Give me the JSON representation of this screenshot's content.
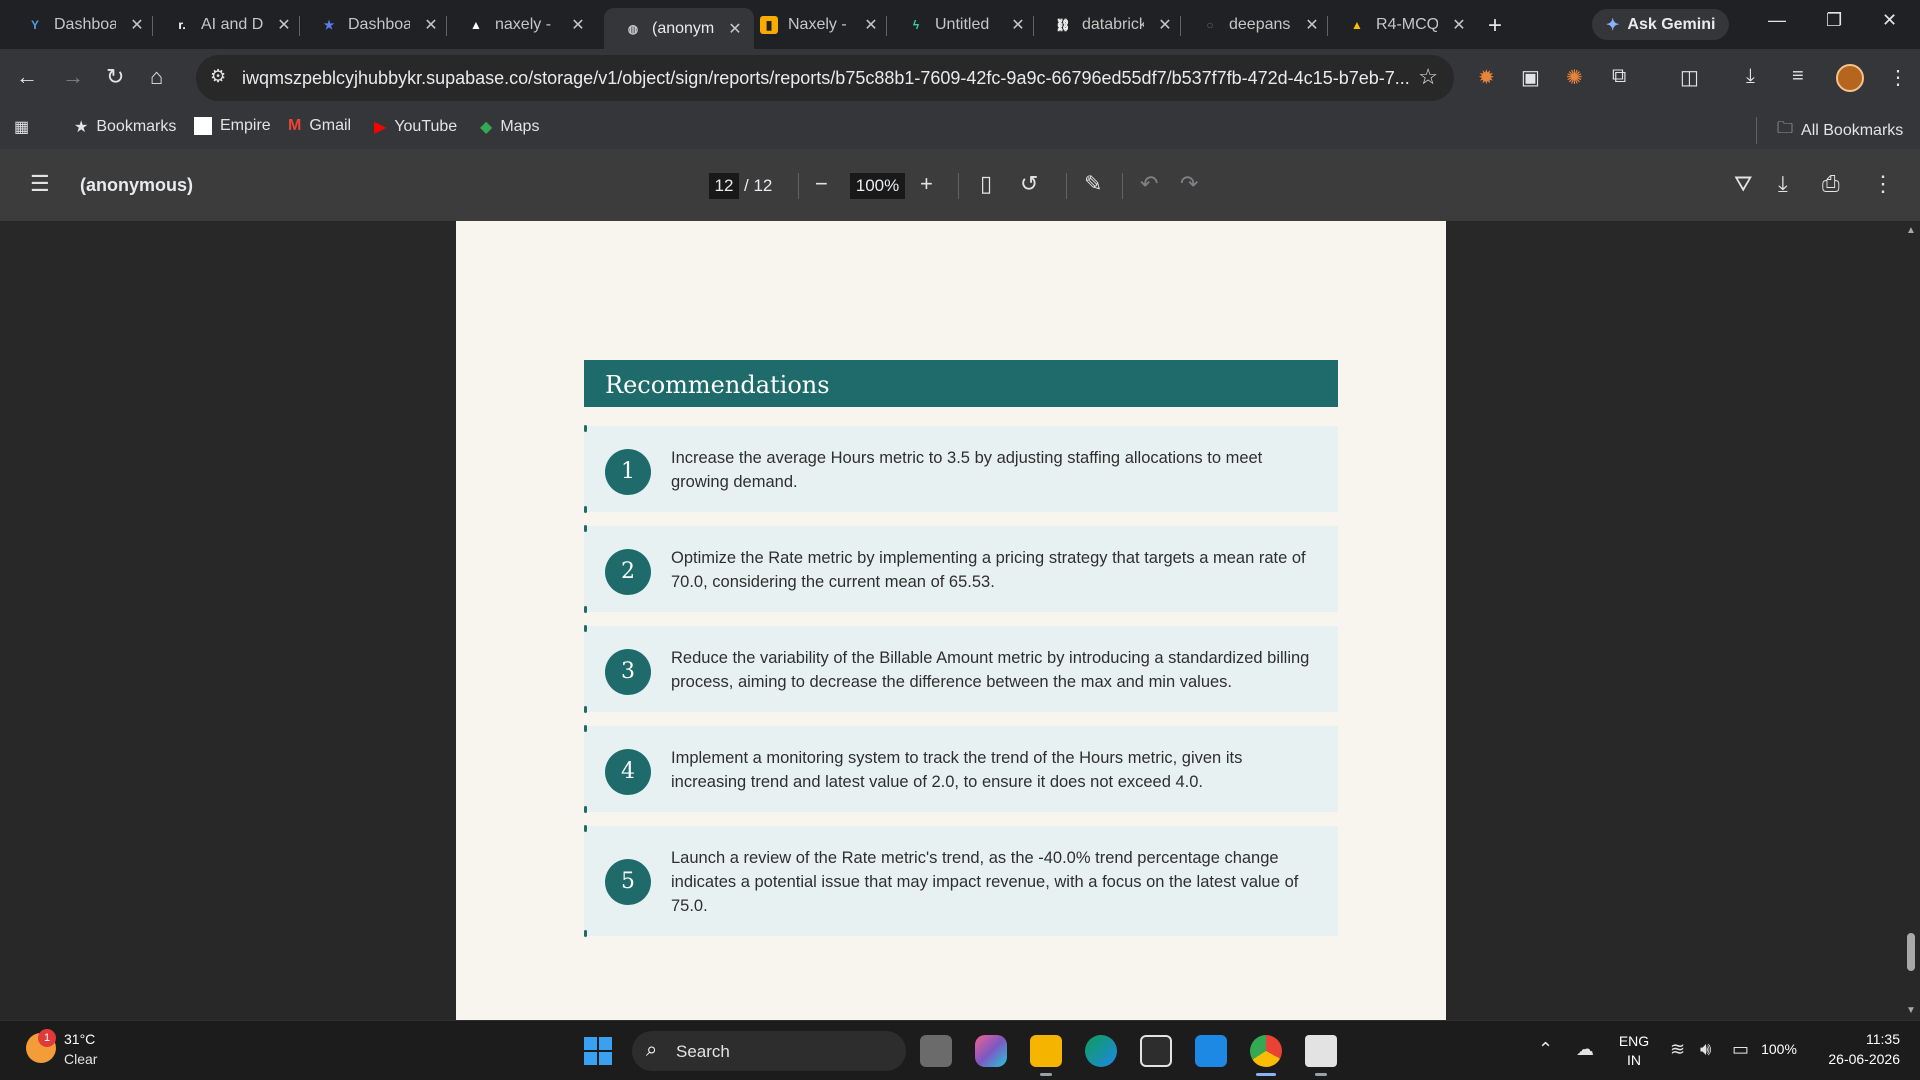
{
  "browser": {
    "tabs": [
      {
        "title": "Dashboard",
        "favicon": "y-logo-icon",
        "color": "#4a9fe8"
      },
      {
        "title": "AI and Data",
        "favicon": "r-logo-icon",
        "color": "#ffffff"
      },
      {
        "title": "Dashboard",
        "favicon": "star-logo-icon",
        "color": "#5b7cf0"
      },
      {
        "title": "naxely -",
        "favicon": "triangle-logo-icon",
        "color": "#ffffff"
      },
      {
        "title": "(anonymous)",
        "favicon": "globe-icon",
        "color": "#c4c7c5",
        "active": true
      },
      {
        "title": "Naxely -",
        "favicon": "bar-chart-icon",
        "color": "#f9ab00"
      },
      {
        "title": "Untitled",
        "favicon": "bolt-icon",
        "color": "#34d399"
      },
      {
        "title": "databricks",
        "favicon": "chain-icon",
        "color": "#ffffff"
      },
      {
        "title": "deepansh",
        "favicon": "blank-icon",
        "color": "#5f6368"
      },
      {
        "title": "R4-MCQ",
        "favicon": "drive-icon",
        "color": "#fbbc04"
      }
    ],
    "ask_gemini": "Ask Gemini",
    "url": "iwqmszpeblcyjhubbykr.supabase.co/storage/v1/object/sign/reports/reports/b75c88b1-7609-42fc-9a9c-66796ed55df7/b537f7fb-472d-4c15-b7eb-7...",
    "bookmarks": [
      {
        "label": "Bookmarks",
        "icon": "star-icon"
      },
      {
        "label": "Empire",
        "icon": "page-icon"
      },
      {
        "label": "Gmail",
        "icon": "gmail-icon"
      },
      {
        "label": "YouTube",
        "icon": "youtube-icon"
      },
      {
        "label": "Maps",
        "icon": "maps-icon"
      }
    ],
    "all_bookmarks": "All Bookmarks"
  },
  "pdf": {
    "title": "(anonymous)",
    "current_page": "12",
    "total_pages": "/ 12",
    "zoom": "100%"
  },
  "report": {
    "section_title": "Recommendations",
    "accent_color": "#1f6b6b",
    "items": [
      {
        "number": "1",
        "text": "Increase the average Hours metric to 3.5 by adjusting staffing allocations to meet growing demand."
      },
      {
        "number": "2",
        "text": "Optimize the Rate metric by implementing a pricing strategy that targets a mean rate of 70.0, considering the current mean of 65.53."
      },
      {
        "number": "3",
        "text": "Reduce the variability of the Billable Amount metric by introducing a standardized billing process, aiming to decrease the difference between the max and min values."
      },
      {
        "number": "4",
        "text": "Implement a monitoring system to track the trend of the Hours metric, given its increasing trend and latest value of 2.0, to ensure it does not exceed 4.0."
      },
      {
        "number": "5",
        "text": "Launch a review of the Rate metric's trend, as the -40.0% trend percentage change indicates a potential issue that may impact revenue, with a focus on the latest value of 75.0."
      }
    ]
  },
  "taskbar": {
    "weather_temp": "31°C",
    "weather_cond": "Clear",
    "weather_badge": "1",
    "search_label": "Search",
    "lang_top": "ENG",
    "lang_bottom": "IN",
    "battery": "100%",
    "time": "11:35",
    "date": "26-06-2026"
  }
}
